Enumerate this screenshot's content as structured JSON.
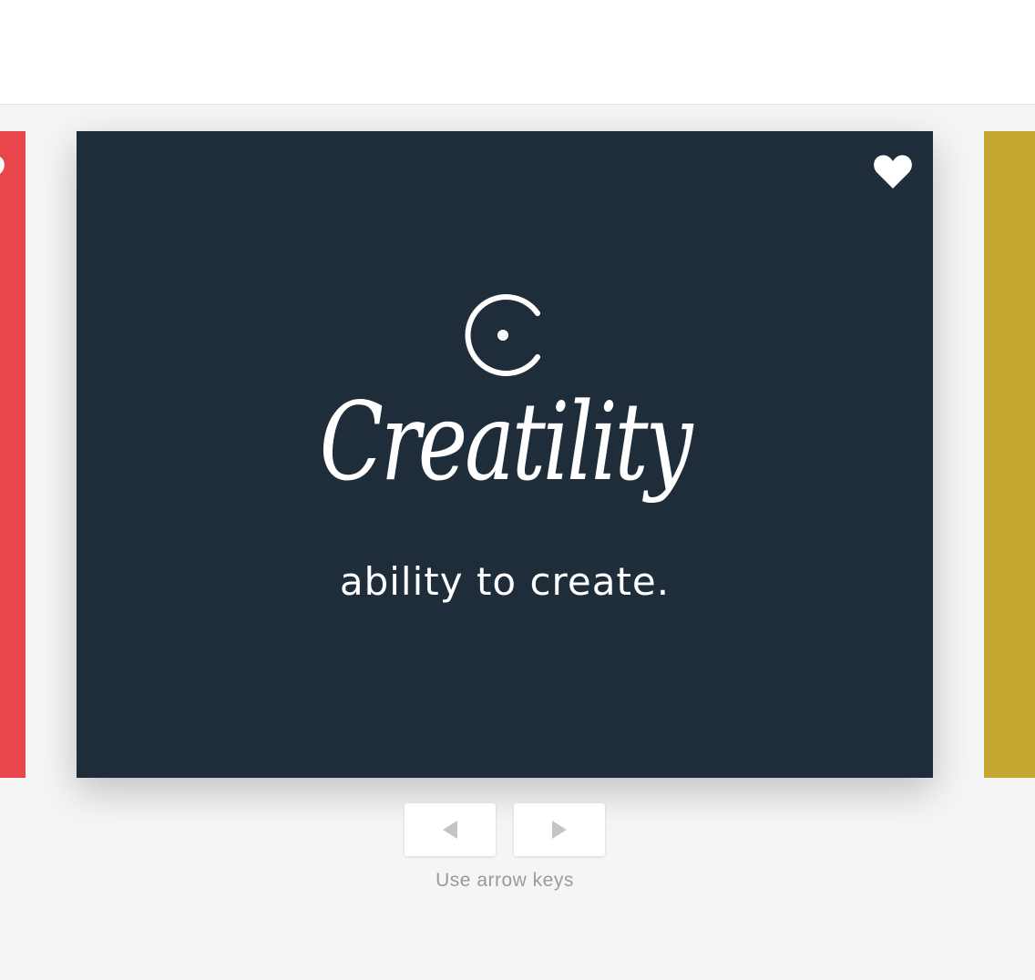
{
  "colors": {
    "page_bg": "#f5f5f5",
    "header_bg": "#ffffff",
    "prev_card": "#e8464a",
    "main_card": "#1f2d3b",
    "next_card": "#c4a82f",
    "heart": "#ffffff",
    "arrow": "#c4c4c4"
  },
  "slides": {
    "prev": {
      "icon": "heart-icon"
    },
    "current": {
      "icon": "heart-icon",
      "logo_icon": "c-logo-icon",
      "brand": "Creatility",
      "tagline": "ability to create."
    },
    "next": {}
  },
  "controls": {
    "prev_icon": "arrow-left-icon",
    "next_icon": "arrow-right-icon",
    "hint": "Use arrow keys"
  }
}
